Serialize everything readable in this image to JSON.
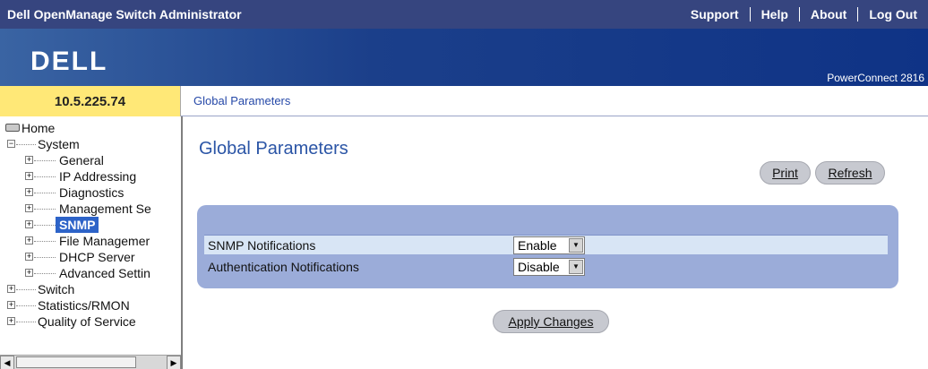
{
  "header": {
    "app_title": "Dell OpenManage Switch Administrator",
    "nav": [
      "Support",
      "Help",
      "About",
      "Log Out"
    ]
  },
  "banner": {
    "logo_text": "DELL",
    "model": "PowerConnect 2816"
  },
  "ip_address": "10.5.225.74",
  "breadcrumb": "Global Parameters",
  "sidebar": {
    "home_label": "Home",
    "items": [
      {
        "label": "System"
      },
      {
        "label": "General"
      },
      {
        "label": "IP Addressing"
      },
      {
        "label": "Diagnostics"
      },
      {
        "label": "Management Se"
      },
      {
        "label": "SNMP",
        "selected": true
      },
      {
        "label": "File Managemer"
      },
      {
        "label": "DHCP Server"
      },
      {
        "label": "Advanced Settin"
      },
      {
        "label": "Switch"
      },
      {
        "label": "Statistics/RMON"
      },
      {
        "label": "Quality of Service"
      }
    ]
  },
  "main": {
    "title": "Global Parameters",
    "print_label": "Print",
    "refresh_label": "Refresh",
    "fields": [
      {
        "label": "SNMP Notifications",
        "value": "Enable"
      },
      {
        "label": "Authentication Notifications",
        "value": "Disable"
      }
    ],
    "apply_label": "Apply Changes"
  }
}
